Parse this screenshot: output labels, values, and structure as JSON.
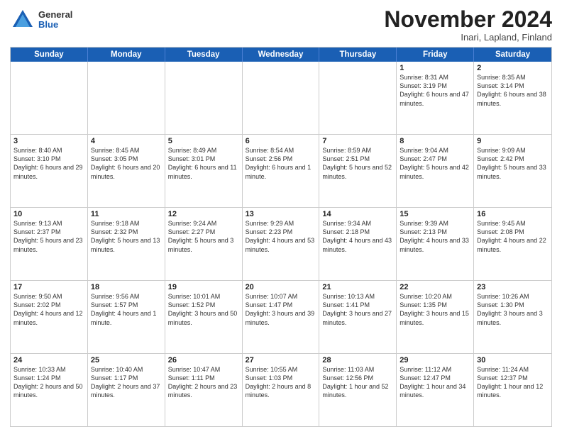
{
  "logo": {
    "general": "General",
    "blue": "Blue"
  },
  "title": "November 2024",
  "location": "Inari, Lapland, Finland",
  "headers": [
    "Sunday",
    "Monday",
    "Tuesday",
    "Wednesday",
    "Thursday",
    "Friday",
    "Saturday"
  ],
  "weeks": [
    [
      {
        "day": "",
        "info": ""
      },
      {
        "day": "",
        "info": ""
      },
      {
        "day": "",
        "info": ""
      },
      {
        "day": "",
        "info": ""
      },
      {
        "day": "",
        "info": ""
      },
      {
        "day": "1",
        "info": "Sunrise: 8:31 AM\nSunset: 3:19 PM\nDaylight: 6 hours and 47 minutes."
      },
      {
        "day": "2",
        "info": "Sunrise: 8:35 AM\nSunset: 3:14 PM\nDaylight: 6 hours and 38 minutes."
      }
    ],
    [
      {
        "day": "3",
        "info": "Sunrise: 8:40 AM\nSunset: 3:10 PM\nDaylight: 6 hours and 29 minutes."
      },
      {
        "day": "4",
        "info": "Sunrise: 8:45 AM\nSunset: 3:05 PM\nDaylight: 6 hours and 20 minutes."
      },
      {
        "day": "5",
        "info": "Sunrise: 8:49 AM\nSunset: 3:01 PM\nDaylight: 6 hours and 11 minutes."
      },
      {
        "day": "6",
        "info": "Sunrise: 8:54 AM\nSunset: 2:56 PM\nDaylight: 6 hours and 1 minute."
      },
      {
        "day": "7",
        "info": "Sunrise: 8:59 AM\nSunset: 2:51 PM\nDaylight: 5 hours and 52 minutes."
      },
      {
        "day": "8",
        "info": "Sunrise: 9:04 AM\nSunset: 2:47 PM\nDaylight: 5 hours and 42 minutes."
      },
      {
        "day": "9",
        "info": "Sunrise: 9:09 AM\nSunset: 2:42 PM\nDaylight: 5 hours and 33 minutes."
      }
    ],
    [
      {
        "day": "10",
        "info": "Sunrise: 9:13 AM\nSunset: 2:37 PM\nDaylight: 5 hours and 23 minutes."
      },
      {
        "day": "11",
        "info": "Sunrise: 9:18 AM\nSunset: 2:32 PM\nDaylight: 5 hours and 13 minutes."
      },
      {
        "day": "12",
        "info": "Sunrise: 9:24 AM\nSunset: 2:27 PM\nDaylight: 5 hours and 3 minutes."
      },
      {
        "day": "13",
        "info": "Sunrise: 9:29 AM\nSunset: 2:23 PM\nDaylight: 4 hours and 53 minutes."
      },
      {
        "day": "14",
        "info": "Sunrise: 9:34 AM\nSunset: 2:18 PM\nDaylight: 4 hours and 43 minutes."
      },
      {
        "day": "15",
        "info": "Sunrise: 9:39 AM\nSunset: 2:13 PM\nDaylight: 4 hours and 33 minutes."
      },
      {
        "day": "16",
        "info": "Sunrise: 9:45 AM\nSunset: 2:08 PM\nDaylight: 4 hours and 22 minutes."
      }
    ],
    [
      {
        "day": "17",
        "info": "Sunrise: 9:50 AM\nSunset: 2:02 PM\nDaylight: 4 hours and 12 minutes."
      },
      {
        "day": "18",
        "info": "Sunrise: 9:56 AM\nSunset: 1:57 PM\nDaylight: 4 hours and 1 minute."
      },
      {
        "day": "19",
        "info": "Sunrise: 10:01 AM\nSunset: 1:52 PM\nDaylight: 3 hours and 50 minutes."
      },
      {
        "day": "20",
        "info": "Sunrise: 10:07 AM\nSunset: 1:47 PM\nDaylight: 3 hours and 39 minutes."
      },
      {
        "day": "21",
        "info": "Sunrise: 10:13 AM\nSunset: 1:41 PM\nDaylight: 3 hours and 27 minutes."
      },
      {
        "day": "22",
        "info": "Sunrise: 10:20 AM\nSunset: 1:35 PM\nDaylight: 3 hours and 15 minutes."
      },
      {
        "day": "23",
        "info": "Sunrise: 10:26 AM\nSunset: 1:30 PM\nDaylight: 3 hours and 3 minutes."
      }
    ],
    [
      {
        "day": "24",
        "info": "Sunrise: 10:33 AM\nSunset: 1:24 PM\nDaylight: 2 hours and 50 minutes."
      },
      {
        "day": "25",
        "info": "Sunrise: 10:40 AM\nSunset: 1:17 PM\nDaylight: 2 hours and 37 minutes."
      },
      {
        "day": "26",
        "info": "Sunrise: 10:47 AM\nSunset: 1:11 PM\nDaylight: 2 hours and 23 minutes."
      },
      {
        "day": "27",
        "info": "Sunrise: 10:55 AM\nSunset: 1:03 PM\nDaylight: 2 hours and 8 minutes."
      },
      {
        "day": "28",
        "info": "Sunrise: 11:03 AM\nSunset: 12:56 PM\nDaylight: 1 hour and 52 minutes."
      },
      {
        "day": "29",
        "info": "Sunrise: 11:12 AM\nSunset: 12:47 PM\nDaylight: 1 hour and 34 minutes."
      },
      {
        "day": "30",
        "info": "Sunrise: 11:24 AM\nSunset: 12:37 PM\nDaylight: 1 hour and 12 minutes."
      }
    ]
  ]
}
